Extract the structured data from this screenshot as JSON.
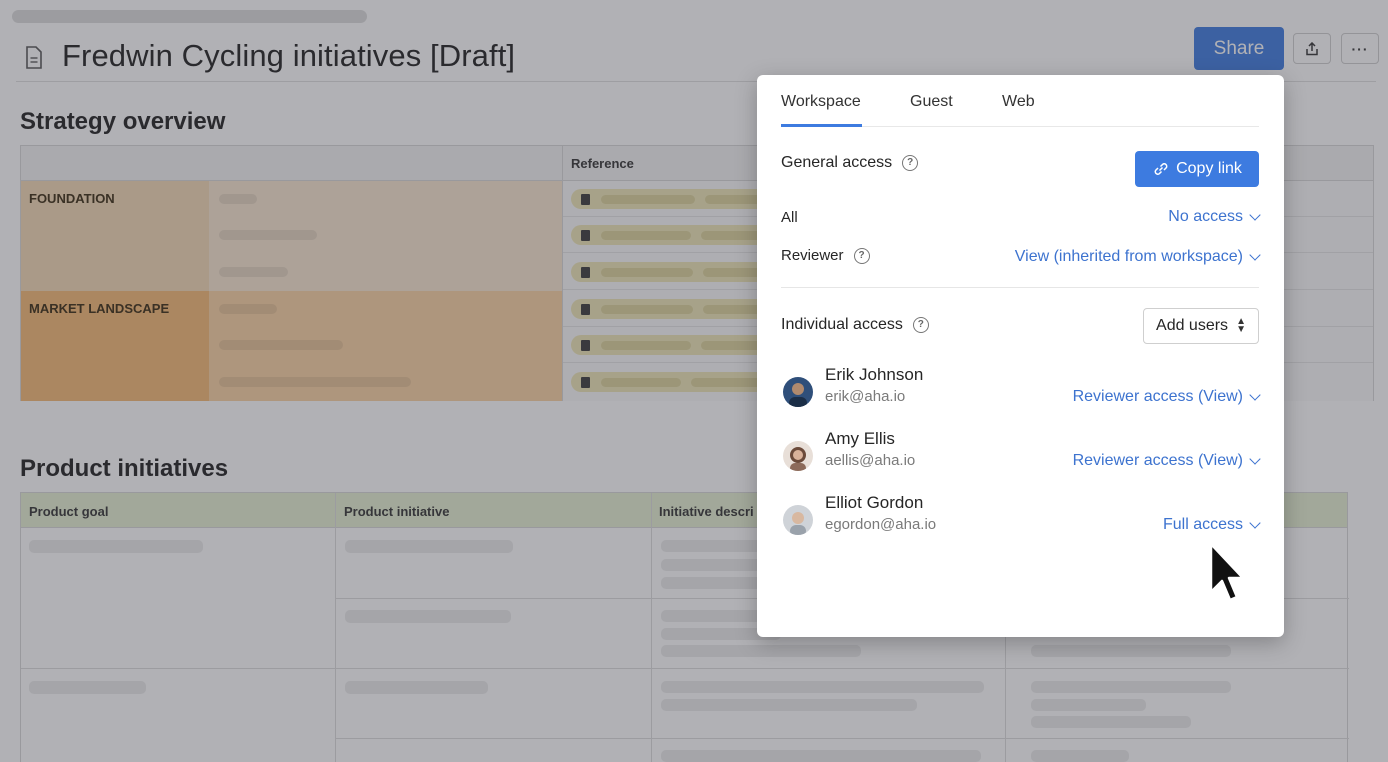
{
  "document": {
    "title": "Fredwin Cycling initiatives [Draft]",
    "share_label": "Share",
    "export_icon": "share-export-icon",
    "more_label": "···"
  },
  "strategy": {
    "heading": "Strategy overview",
    "reference_header": "Reference",
    "categories": [
      "FOUNDATION",
      "MARKET LANDSCAPE"
    ]
  },
  "product": {
    "heading": "Product initiatives",
    "columns": [
      "Product goal",
      "Product initiative",
      "Initiative descri"
    ]
  },
  "share_popover": {
    "tabs": [
      "Workspace",
      "Guest",
      "Web"
    ],
    "active_tab": "Workspace",
    "general_access_title": "General access",
    "copy_link_label": "Copy link",
    "rows": [
      {
        "label": "All",
        "value": "No access"
      },
      {
        "label": "Reviewer",
        "value": "View (inherited from workspace)"
      }
    ],
    "individual_access_title": "Individual access",
    "add_users_label": "Add users",
    "users": [
      {
        "name": "Erik Johnson",
        "email": "erik@aha.io",
        "access": "Reviewer access (View)"
      },
      {
        "name": "Amy Ellis",
        "email": "aellis@aha.io",
        "access": "Reviewer access (View)"
      },
      {
        "name": "Elliot Gordon",
        "email": "egordon@aha.io",
        "access": "Full access"
      }
    ]
  },
  "colors": {
    "accent": "#3d7be0",
    "link": "#3d73cf",
    "foundation": "#f3d9b5",
    "market_landscape": "#f5b974",
    "product_header": "#e6f0d2"
  }
}
